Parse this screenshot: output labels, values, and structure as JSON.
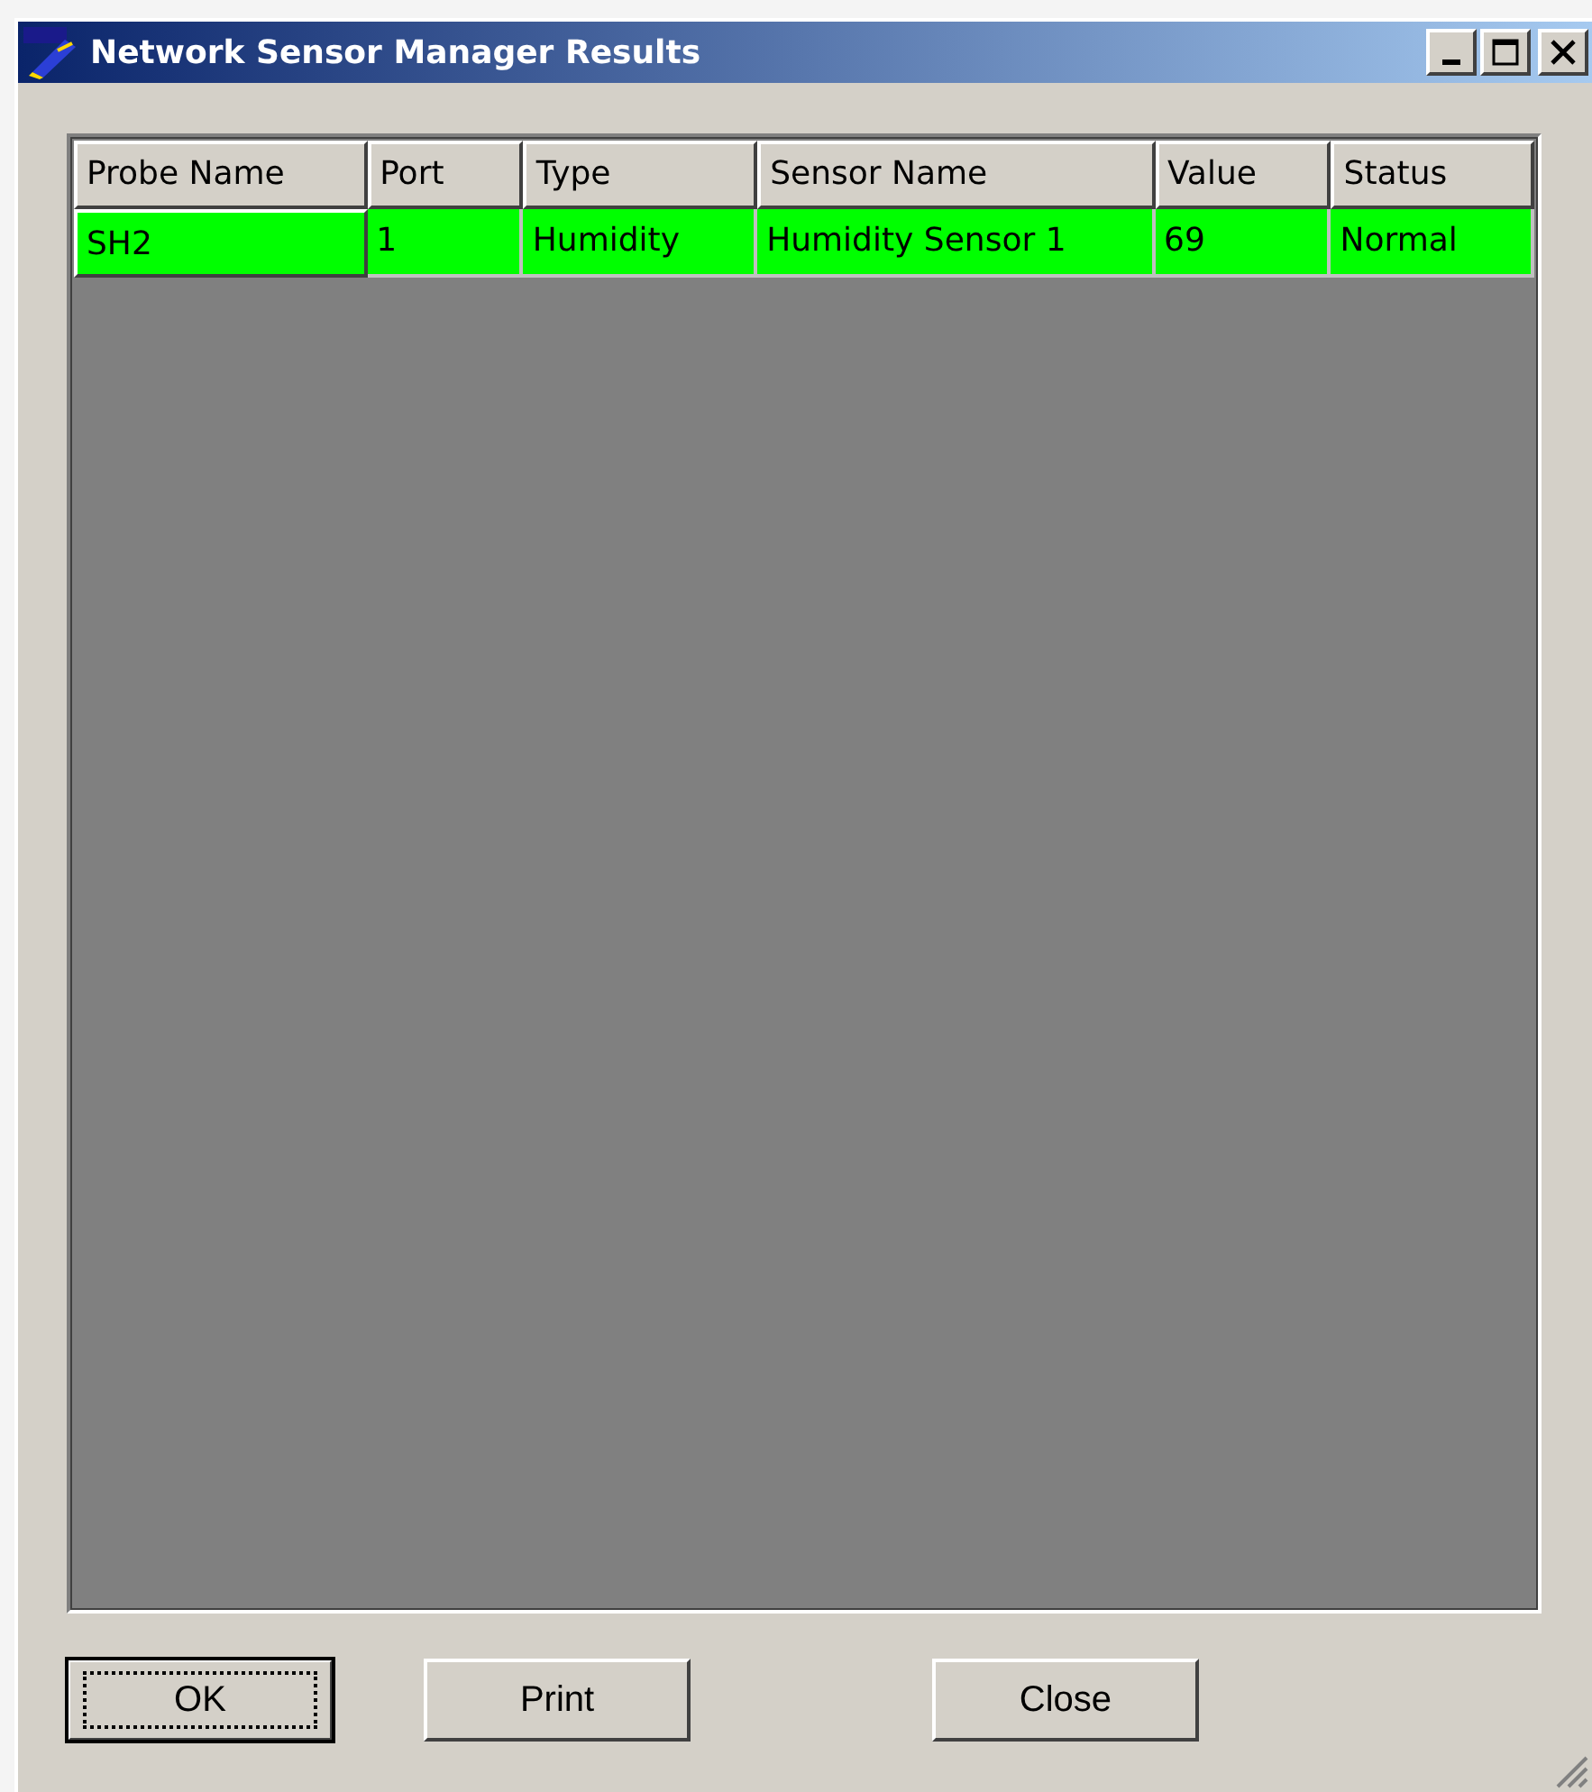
{
  "window": {
    "title": "Network Sensor Manager Results"
  },
  "table": {
    "columns": [
      "Probe Name",
      "Port",
      "Type",
      "Sensor Name",
      "Value",
      "Status"
    ],
    "rows": [
      {
        "color": "#00ff00",
        "cells": [
          "SH2",
          "1",
          "Humidity",
          "Humidity Sensor 1",
          "69",
          "Normal"
        ]
      }
    ]
  },
  "buttons": [
    {
      "label": "OK",
      "default": true
    },
    {
      "label": "Print",
      "default": false
    },
    {
      "label": "Close",
      "default": false
    }
  ]
}
